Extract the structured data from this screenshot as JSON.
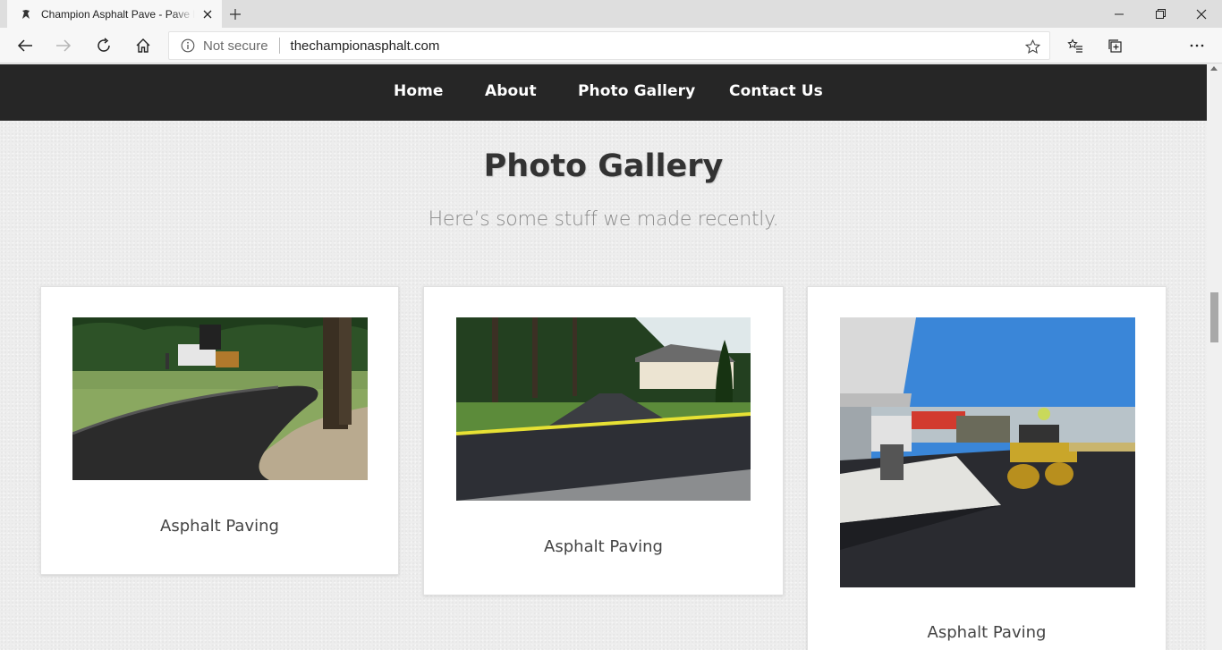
{
  "browser": {
    "tab_title": "Champion Asphalt Pave - Pave li",
    "address_security": "Not secure",
    "url": "thechampionasphalt.com",
    "icons": [
      "favicon-icon",
      "close-icon",
      "plus-icon",
      "minimize-icon",
      "restore-icon",
      "close-window-icon",
      "back-icon",
      "forward-icon",
      "refresh-icon",
      "home-icon",
      "info-icon",
      "star-icon",
      "favorites-icon",
      "collections-icon",
      "more-icon"
    ]
  },
  "nav": {
    "items": [
      "Home",
      "About",
      "Photo Gallery",
      "Contact Us"
    ]
  },
  "gallery": {
    "title": "Photo Gallery",
    "subtitle": "Here’s some stuff we made recently.",
    "cards": [
      {
        "caption": "Asphalt Paving",
        "image": "curved-driveway-photo"
      },
      {
        "caption": "Asphalt Paving",
        "image": "residential-driveway-photo"
      },
      {
        "caption": "Asphalt Paving",
        "image": "gas-station-paving-photo"
      }
    ]
  }
}
